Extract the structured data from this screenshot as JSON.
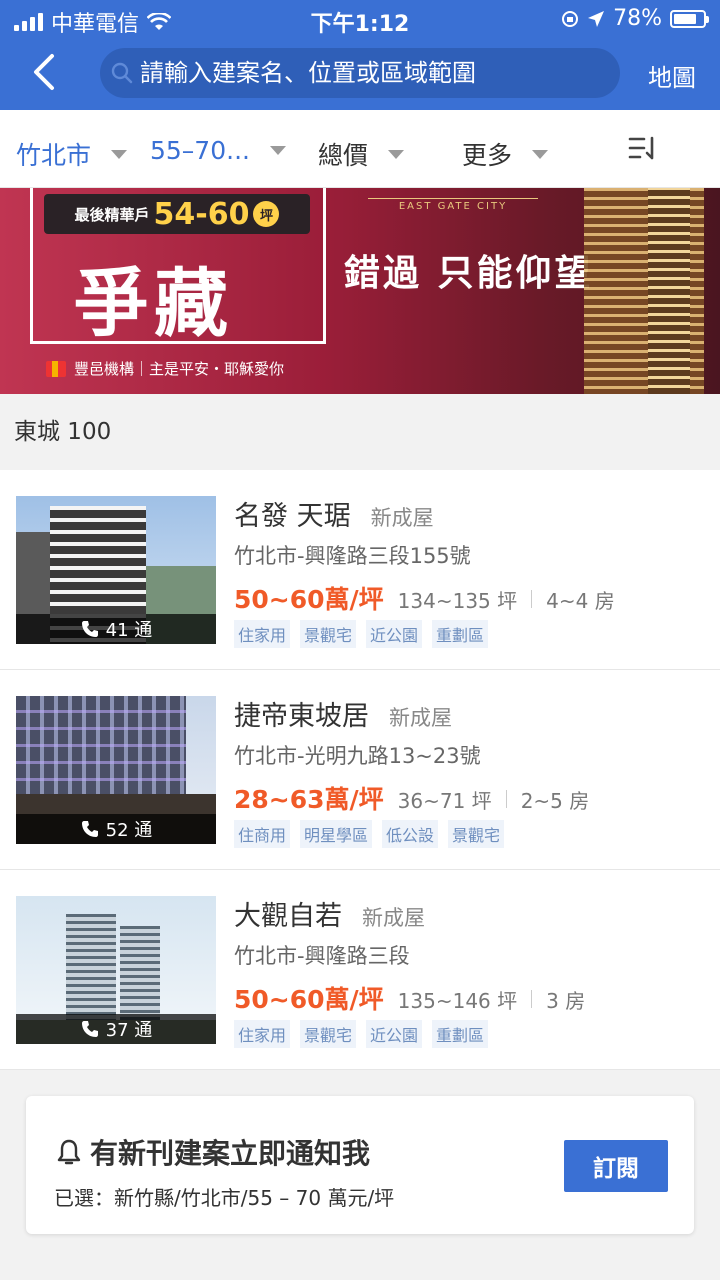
{
  "status_bar": {
    "carrier": "中華電信",
    "time": "下午1:12",
    "battery": "78%",
    "battery_level": 0.78
  },
  "header": {
    "search_placeholder": "請輸入建案名、位置或區域範圍",
    "map_label": "地圖"
  },
  "filters": [
    {
      "label": "竹北市",
      "active": true
    },
    {
      "label": "55–70...",
      "active": true
    },
    {
      "label": "總價",
      "active": false
    },
    {
      "label": "更多",
      "active": false
    }
  ],
  "banner": {
    "tag_prefix": "最後精華戶",
    "tag_range": "54-60",
    "tag_unit": "坪",
    "headline": "爭藏",
    "brand": "豐邑機構｜主是平安・耶穌愛你",
    "subtitle_en": "EAST GATE CITY",
    "slogan": "錯過 只能仰望"
  },
  "section_title": "東城 100",
  "listings": [
    {
      "name": "名發 天琚",
      "type": "新成屋",
      "address": "竹北市-興隆路三段155號",
      "price": "50~60萬/坪",
      "area": "134~135 坪",
      "rooms": "4~4 房",
      "calls": "41 通",
      "tags": [
        "住家用",
        "景觀宅",
        "近公園",
        "重劃區"
      ]
    },
    {
      "name": "捷帝東坡居",
      "type": "新成屋",
      "address": "竹北市-光明九路13~23號",
      "price": "28~63萬/坪",
      "area": "36~71 坪",
      "rooms": "2~5 房",
      "calls": "52 通",
      "tags": [
        "住商用",
        "明星學區",
        "低公設",
        "景觀宅"
      ]
    },
    {
      "name": "大觀自若",
      "type": "新成屋",
      "address": "竹北市-興隆路三段",
      "price": "50~60萬/坪",
      "area": "135~146 坪",
      "rooms": "3 房",
      "calls": "37 通",
      "tags": [
        "住家用",
        "景觀宅",
        "近公園",
        "重劃區"
      ]
    }
  ],
  "subscribe": {
    "title": "有新刊建案立即通知我",
    "selected": "已選：新竹縣/竹北市/55 – 70 萬元/坪",
    "button": "訂閱"
  },
  "colors": {
    "primary": "#3a70d4",
    "price": "#f05a28"
  }
}
